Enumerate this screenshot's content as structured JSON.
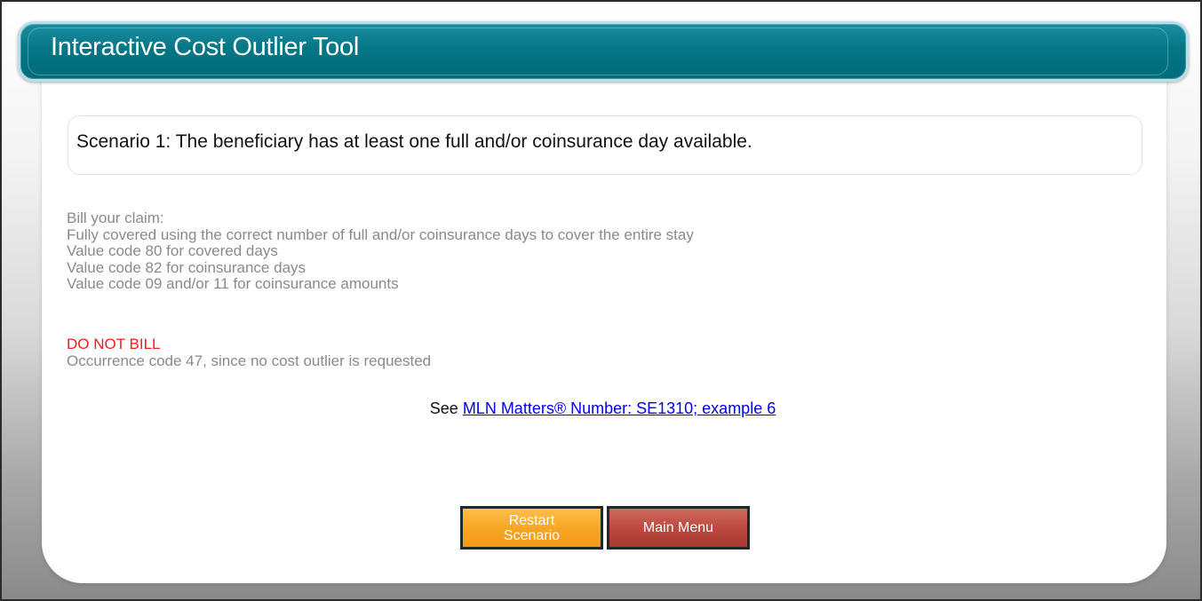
{
  "header": {
    "title": "Interactive Cost Outlier Tool"
  },
  "scenario": {
    "text": "Scenario 1: The beneficiary has at least one full and/or coinsurance day available."
  },
  "bill_claim": {
    "heading": "Bill your claim:",
    "lines": [
      "Fully covered using the correct number of full and/or coinsurance days to cover the entire stay",
      "Value code 80 for covered days",
      "Value code 82 for coinsurance days",
      "Value code 09 and/or 11 for coinsurance amounts"
    ]
  },
  "do_not_bill": {
    "heading": "DO NOT BILL",
    "text": "Occurrence code 47, since no cost outlier is requested"
  },
  "reference": {
    "prefix": "See ",
    "link_text": "MLN Matters® Number: SE1310; example 6"
  },
  "buttons": {
    "restart_line1": "Restart",
    "restart_line2": "Scenario",
    "main_menu": "Main Menu"
  },
  "colors": {
    "header_teal": "#037686",
    "warning_red": "#ff1a1a",
    "restart_orange": "#f8a423",
    "main_menu_red": "#b9473d",
    "link_blue": "#0000ee"
  }
}
